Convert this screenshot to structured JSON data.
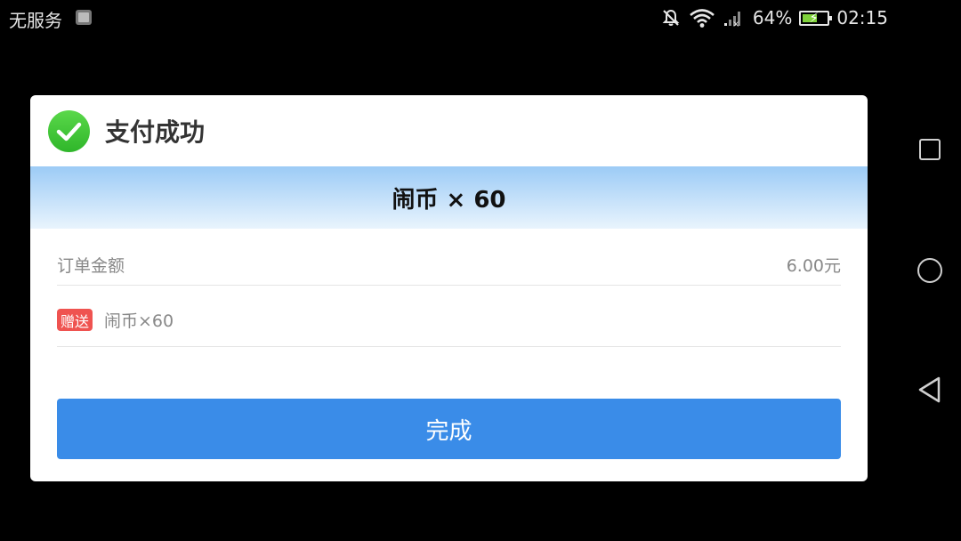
{
  "status_bar": {
    "carrier": "无服务",
    "battery_percent": "64%",
    "battery_level": 0.64,
    "time": "02:15"
  },
  "dialog": {
    "title": "支付成功",
    "product": "闹币 × 60",
    "order_amount_label": "订单金额",
    "order_amount_value": "6.00元",
    "gift_badge": "赠送",
    "gift_text": "闹币×60",
    "done_label": "完成"
  },
  "colors": {
    "success_green": "#2fb62a",
    "primary_blue": "#3a8ce8",
    "gift_red": "#ef5350",
    "band_blue": "#9ccbf6"
  },
  "icons": [
    "image-icon",
    "mute-icon",
    "wifi-icon",
    "signal-icon",
    "battery-icon",
    "success-check-icon",
    "recent-apps-icon",
    "home-icon",
    "back-icon"
  ]
}
